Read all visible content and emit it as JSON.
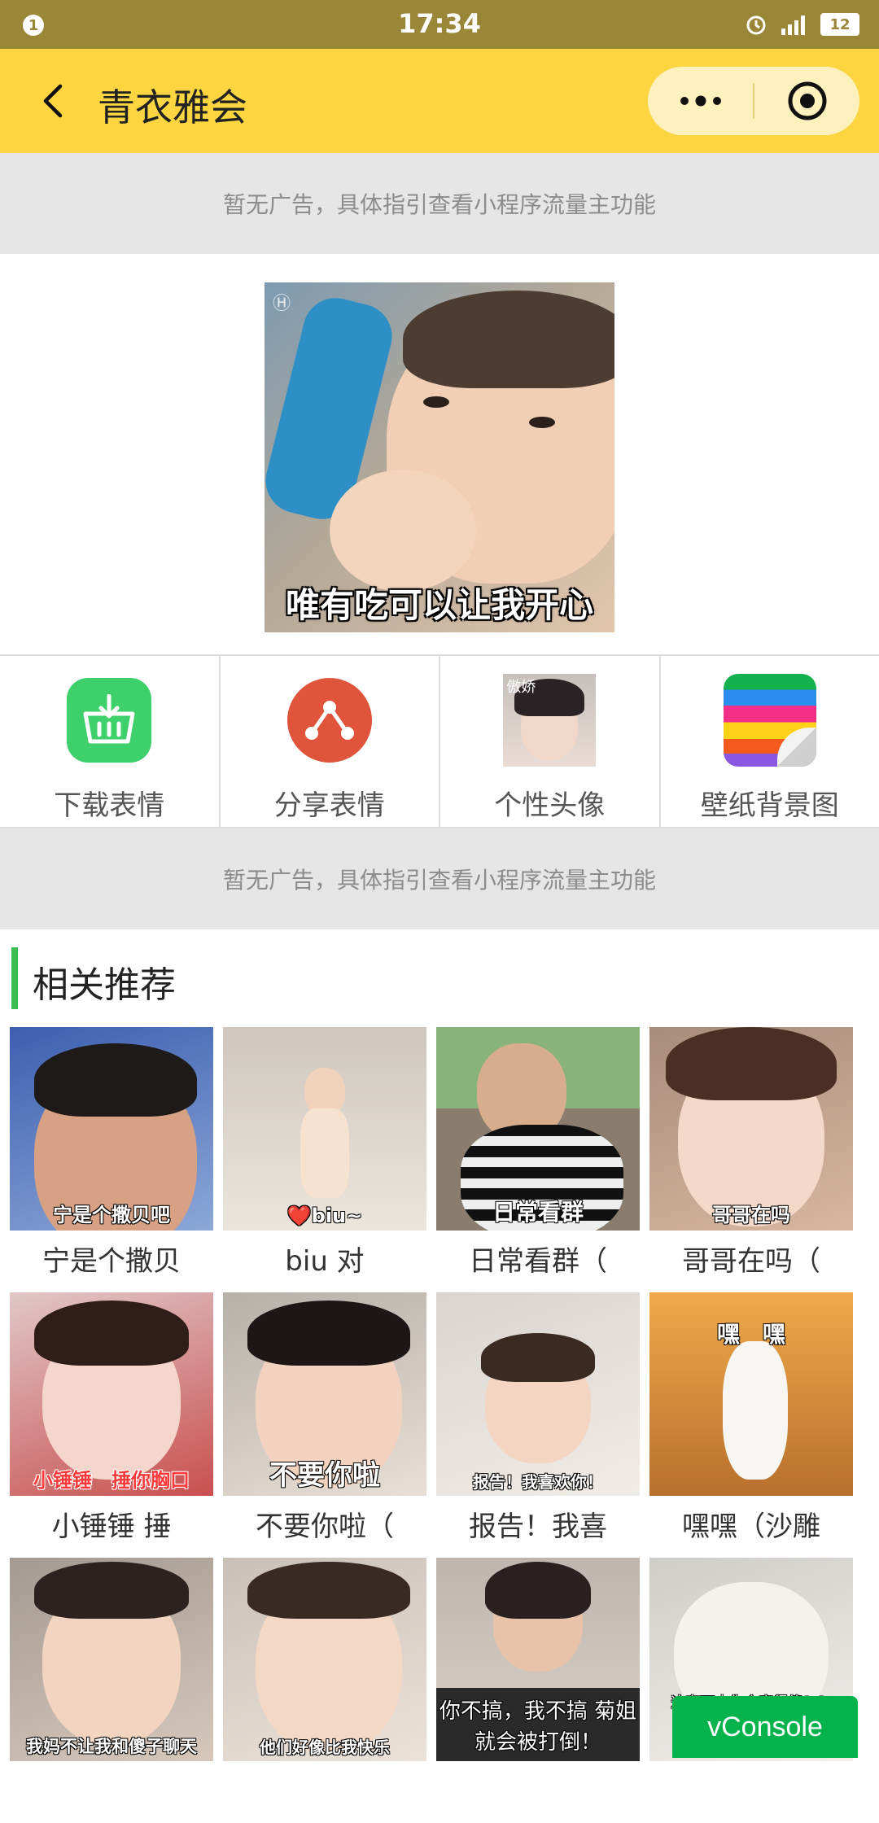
{
  "status_bar": {
    "notification": "1",
    "time": "17:34",
    "battery": "12",
    "network": "4G"
  },
  "nav": {
    "title": "青衣雅会"
  },
  "ads": {
    "top_text": "暂无广告，具体指引查看小程序流量主功能",
    "middle_text": "暂无广告，具体指引查看小程序流量主功能"
  },
  "hero": {
    "caption": "唯有吃可以让我开心"
  },
  "menu": [
    {
      "label": "下载表情",
      "icon": "download-basket-icon"
    },
    {
      "label": "分享表情",
      "icon": "share-icon"
    },
    {
      "label": "个性头像",
      "icon": "avatar-thumbnail",
      "thumb_text": "傲娇"
    },
    {
      "label": "壁纸背景图",
      "icon": "wallpaper-icon"
    }
  ],
  "section": {
    "title": "相关推荐"
  },
  "recommend": [
    {
      "label": "宁是个撒贝",
      "caption": "宁是个撒贝吧"
    },
    {
      "label": "biu 对",
      "caption": "❤️biu~"
    },
    {
      "label": "日常看群（",
      "caption": "日常看群"
    },
    {
      "label": "哥哥在吗（",
      "caption": "哥哥在吗"
    },
    {
      "label": "小锤锤 捶",
      "caption": "小锤锤　捶你胸口"
    },
    {
      "label": "不要你啦（",
      "caption": "不要你啦"
    },
    {
      "label": "报告！我喜",
      "caption": "报告！我喜欢你！"
    },
    {
      "label": "嘿嘿（沙雕",
      "caption": "嘿　嘿"
    },
    {
      "label": "",
      "caption": "我妈不让我和傻子聊天"
    },
    {
      "label": "",
      "caption": "他们好像比我快乐"
    },
    {
      "label": "",
      "caption": "你不搞，我不搞 菊姐就会被打倒！"
    },
    {
      "label": "",
      "caption": "这套下去你会变得傻fufu"
    }
  ],
  "vconsole": {
    "label": "vConsole"
  }
}
